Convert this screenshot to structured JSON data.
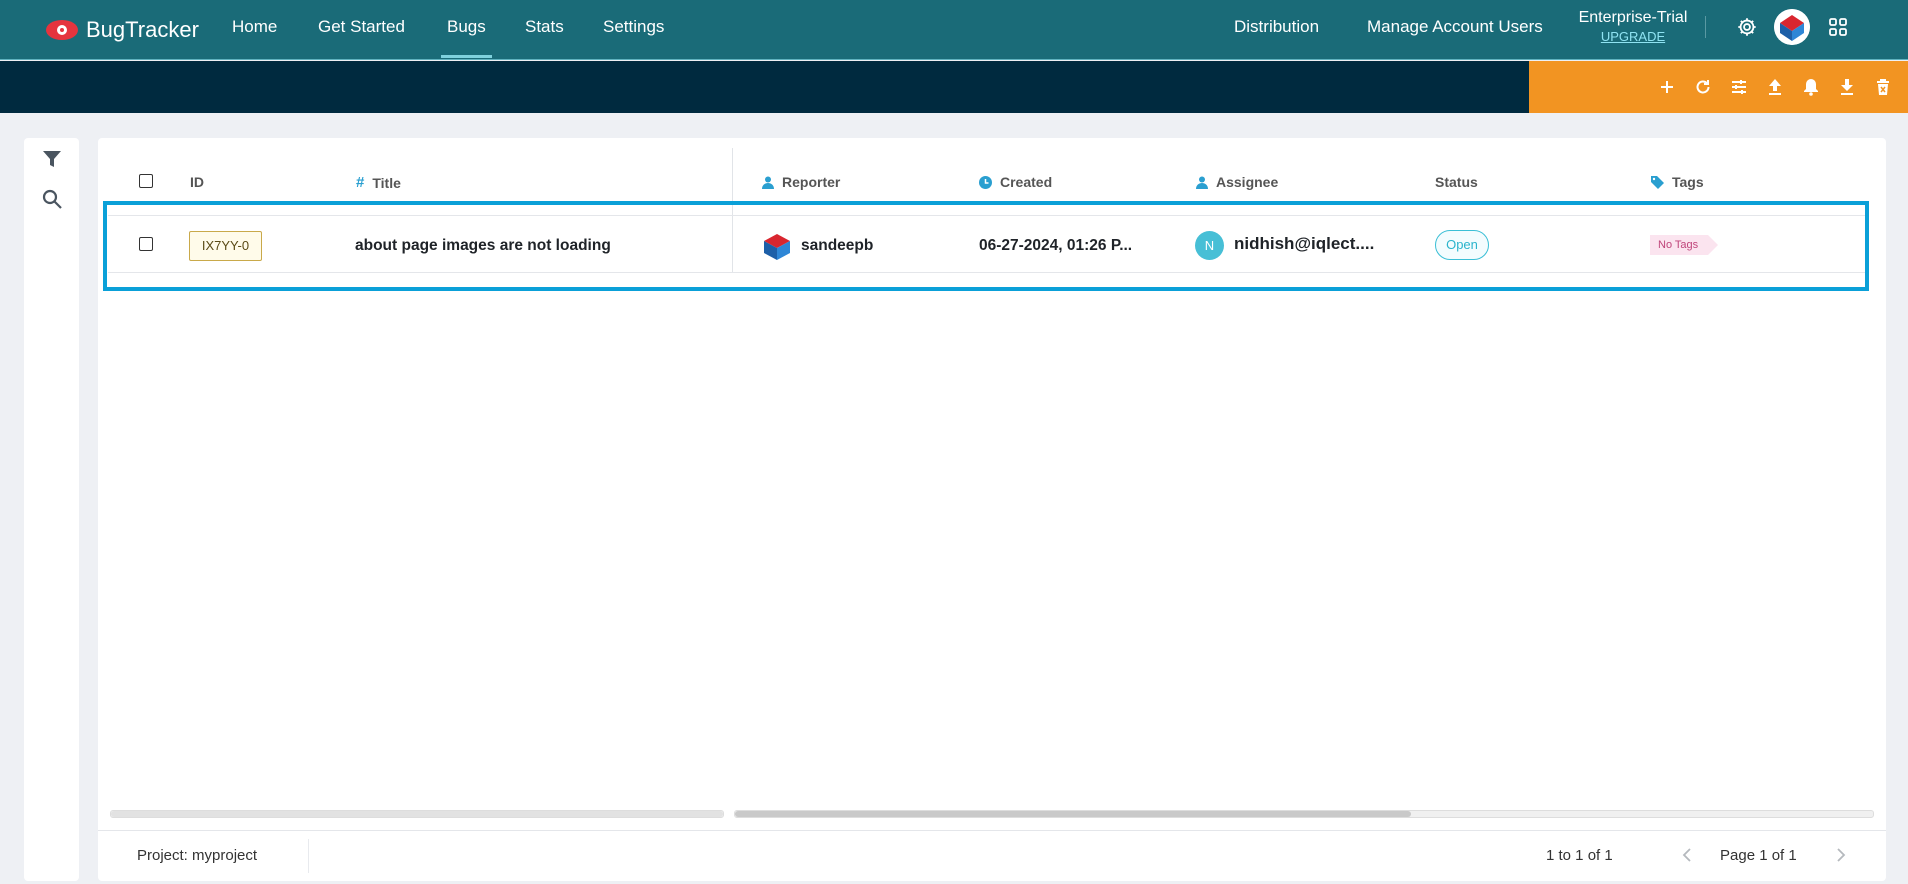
{
  "app": {
    "name": "BugTracker"
  },
  "nav": {
    "items": [
      {
        "label": "Home"
      },
      {
        "label": "Get Started"
      },
      {
        "label": "Bugs"
      },
      {
        "label": "Stats"
      },
      {
        "label": "Settings"
      }
    ],
    "active": "Bugs",
    "right": {
      "distribution": "Distribution",
      "manage_users": "Manage Account Users"
    },
    "plan": {
      "name": "Enterprise-Trial",
      "upgrade": "UPGRADE"
    }
  },
  "colors": {
    "nav_bg": "#1a6b78",
    "subbar_bg": "#002a3f",
    "action_bar_bg": "#f29422",
    "highlight": "#0aa0d8"
  },
  "toolbar_icons": [
    "plus-icon",
    "refresh-icon",
    "sliders-icon",
    "upload-icon",
    "bell-icon",
    "download-icon",
    "trash-icon"
  ],
  "table": {
    "columns": {
      "id": "ID",
      "title": "Title",
      "reporter": "Reporter",
      "created": "Created",
      "assignee": "Assignee",
      "status": "Status",
      "tags": "Tags"
    },
    "rows": [
      {
        "id": "IX7YY-0",
        "title": "about page images are not loading",
        "reporter": "sandeepb",
        "created": "06-27-2024, 01:26 P...",
        "assignee_initial": "N",
        "assignee": "nidhish@iqlect....",
        "status": "Open",
        "tags": "No Tags"
      }
    ]
  },
  "footer": {
    "project": "Project: myproject",
    "count": "1 to 1 of 1",
    "page": "Page 1 of 1"
  }
}
